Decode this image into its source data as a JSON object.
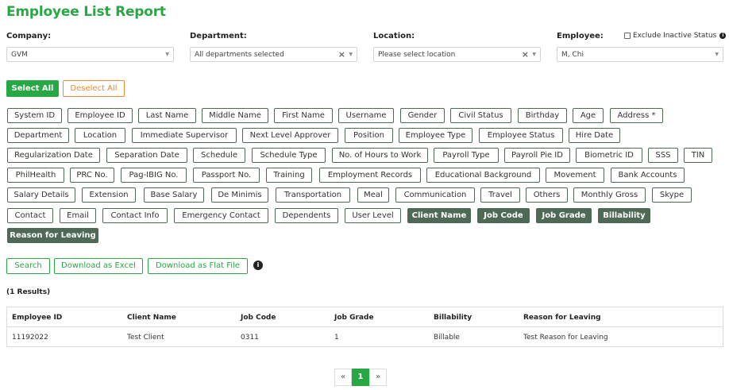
{
  "page": {
    "title": "Employee List Report"
  },
  "filters": {
    "company": {
      "label": "Company:",
      "value": "GVM"
    },
    "department": {
      "label": "Department:",
      "value": "All departments selected"
    },
    "location": {
      "label": "Location:",
      "value": "Please select location"
    },
    "employee": {
      "label": "Employee:",
      "value": "M, Chi"
    },
    "exclude_inactive": {
      "label": "Exclude Inactive Status",
      "checked": false
    }
  },
  "select_all": "Select All",
  "deselect_all": "Deselect All",
  "fields": [
    {
      "label": "System ID",
      "selected": false
    },
    {
      "label": "Employee ID",
      "selected": true
    },
    {
      "label": "Last Name",
      "selected": false
    },
    {
      "label": "Middle Name",
      "selected": false
    },
    {
      "label": "First Name",
      "selected": false
    },
    {
      "label": "Username",
      "selected": false
    },
    {
      "label": "Gender",
      "selected": false
    },
    {
      "label": "Civil Status",
      "selected": false
    },
    {
      "label": "Birthday",
      "selected": false
    },
    {
      "label": "Age",
      "selected": false
    },
    {
      "label": "Address *",
      "selected": false
    },
    {
      "label": "Department",
      "selected": false
    },
    {
      "label": "Location",
      "selected": false
    },
    {
      "label": "Immediate Supervisor",
      "selected": false
    },
    {
      "label": "Next Level Approver",
      "selected": false
    },
    {
      "label": "Position",
      "selected": false
    },
    {
      "label": "Employee Type",
      "selected": false
    },
    {
      "label": "Employee Status",
      "selected": false
    },
    {
      "label": "Hire Date",
      "selected": false
    },
    {
      "label": "Regularization Date",
      "selected": false
    },
    {
      "label": "Separation Date",
      "selected": false
    },
    {
      "label": "Schedule",
      "selected": false
    },
    {
      "label": "Schedule Type",
      "selected": false
    },
    {
      "label": "No. of Hours to Work",
      "selected": false
    },
    {
      "label": "Payroll Type",
      "selected": false
    },
    {
      "label": "Payroll Pie ID",
      "selected": false
    },
    {
      "label": "Biometric ID",
      "selected": false
    },
    {
      "label": "SSS",
      "selected": false
    },
    {
      "label": "TIN",
      "selected": false
    },
    {
      "label": "PhilHealth",
      "selected": false
    },
    {
      "label": "PRC No.",
      "selected": false
    },
    {
      "label": "Pag-IBIG No.",
      "selected": false
    },
    {
      "label": "Passport No.",
      "selected": false
    },
    {
      "label": "Training",
      "selected": false
    },
    {
      "label": "Employment Records",
      "selected": false
    },
    {
      "label": "Educational Background",
      "selected": false
    },
    {
      "label": "Movement",
      "selected": false
    },
    {
      "label": "Bank Accounts",
      "selected": false
    },
    {
      "label": "Salary Details",
      "selected": false
    },
    {
      "label": "Extension",
      "selected": false
    },
    {
      "label": "Base Salary",
      "selected": false
    },
    {
      "label": "De Minimis",
      "selected": false
    },
    {
      "label": "Transportation",
      "selected": false
    },
    {
      "label": "Meal",
      "selected": false
    },
    {
      "label": "Communication",
      "selected": false
    },
    {
      "label": "Travel",
      "selected": false
    },
    {
      "label": "Others",
      "selected": false
    },
    {
      "label": "Monthly Gross",
      "selected": false
    },
    {
      "label": "Skype",
      "selected": false
    },
    {
      "label": "Contact",
      "selected": false
    },
    {
      "label": "Email",
      "selected": false
    },
    {
      "label": "Contact Info",
      "selected": false
    },
    {
      "label": "Emergency Contact",
      "selected": false
    },
    {
      "label": "Dependents",
      "selected": false
    },
    {
      "label": "User Level",
      "selected": false
    },
    {
      "label": "Client Name",
      "selected": true
    },
    {
      "label": "Job Code",
      "selected": true
    },
    {
      "label": "Job Grade",
      "selected": true
    },
    {
      "label": "Billability",
      "selected": true
    },
    {
      "label": "Reason for Leaving",
      "selected": true
    }
  ],
  "actions": {
    "search": "Search",
    "download_excel": "Download as Excel",
    "download_flat": "Download as Flat File"
  },
  "results_label": "(1 Results)",
  "table": {
    "columns": [
      "Employee ID",
      "Client Name",
      "Job Code",
      "Job Grade",
      "Billability",
      "Reason for Leaving"
    ],
    "rows": [
      [
        "11192022",
        "Test Client",
        "0311",
        "1",
        "Billable",
        "Test Reason for Leaving"
      ]
    ]
  },
  "pagination": {
    "prev": "«",
    "current": "1",
    "next": "»"
  },
  "colors": {
    "accent": "#28a745",
    "chip_selected": "#4e6a57",
    "deselect": "#f0882d"
  }
}
